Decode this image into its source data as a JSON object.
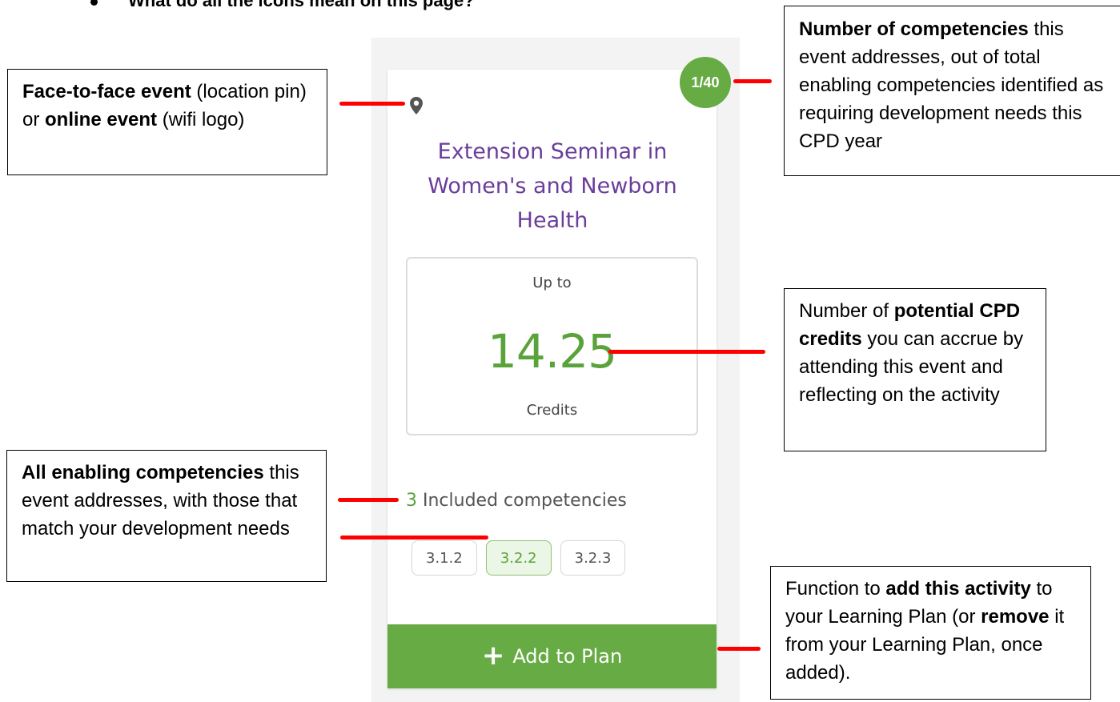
{
  "heading": "What do all the icons mean on this page?",
  "annotations": {
    "location": {
      "b1": "Face-to-face event",
      "t1": " (location pin) or ",
      "b2": "online event",
      "t2": " (wifi logo)"
    },
    "competency_count": {
      "b1": "Number of competencies",
      "t1": " this event addresses, out of total enabling competencies identified as requiring development needs this CPD year"
    },
    "credits": {
      "t1": "Number of ",
      "b1": "potential CPD credits",
      "t2": " you can accrue by attending this event and reflecting on the activity"
    },
    "competencies": {
      "b1": "All enabling competencies",
      "t1": " this event addresses, with those that match your development needs"
    },
    "add_plan": {
      "t1": "Function to ",
      "b1": "add this activity",
      "t2": " to your Learning Plan (or ",
      "b2": "remove",
      "t3": " it from your Learning Plan, once added)."
    }
  },
  "card": {
    "badge": "1/40",
    "title_lines": [
      "Extension Seminar in",
      "Women's and Newborn",
      "Health"
    ],
    "credits_prefix": "Up to",
    "credits_value": "14.25",
    "credits_label": "Credits",
    "included_count": "3",
    "included_label": " Included competencies",
    "competencies": [
      {
        "code": "3.1.2",
        "match": false
      },
      {
        "code": "3.2.2",
        "match": true
      },
      {
        "code": "3.2.3",
        "match": false
      }
    ],
    "add_button": "Add to Plan",
    "icons": {
      "location": "map-pin-icon",
      "add": "plus-icon"
    }
  },
  "colors": {
    "accent_green": "#67ab45",
    "title_purple": "#6a3d9a",
    "pointer_red": "#ff0000"
  }
}
